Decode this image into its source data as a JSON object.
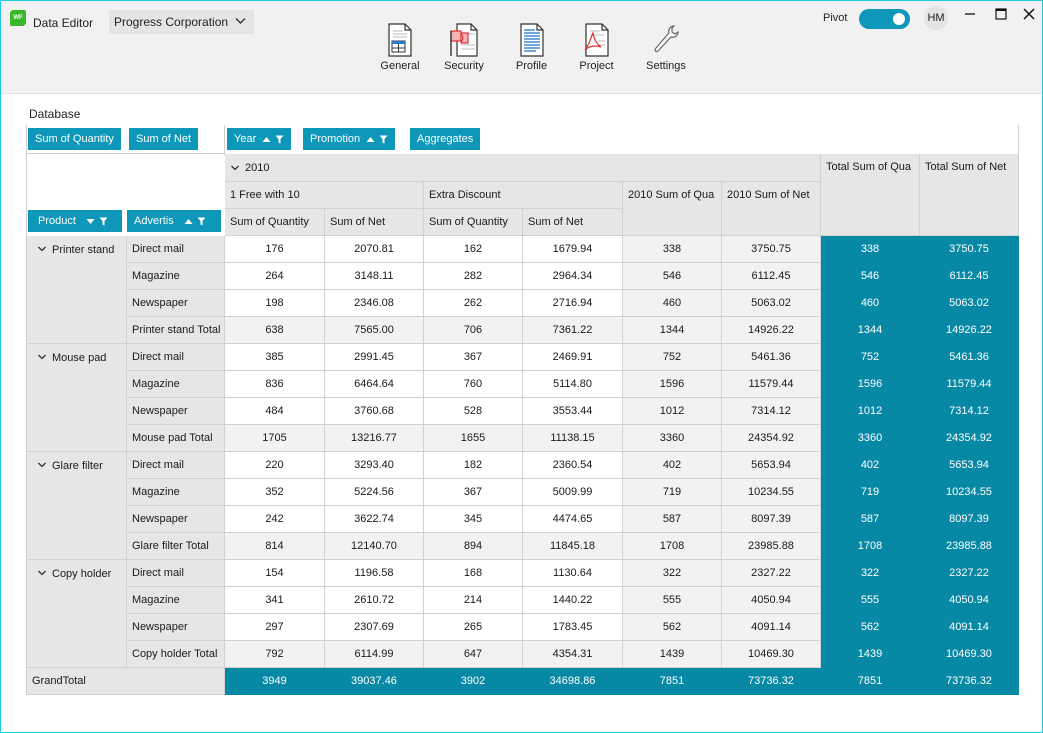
{
  "app": {
    "title": "Data Editor",
    "logo_text": "WF",
    "company": "Progress Corporation"
  },
  "ribbon": [
    {
      "label": "General",
      "icon": "general-doc-icon"
    },
    {
      "label": "Security",
      "icon": "security-flag-icon"
    },
    {
      "label": "Profile",
      "icon": "profile-doc-icon"
    },
    {
      "label": "Project",
      "icon": "project-pdf-icon"
    },
    {
      "label": "Settings",
      "icon": "settings-wrench-icon"
    }
  ],
  "header_right": {
    "pivot_label": "Pivot",
    "pivot_on": true,
    "avatar_initials": "HM"
  },
  "section_title": "Database",
  "fields": {
    "data_fields": [
      "Sum of Quantity",
      "Sum of Net"
    ],
    "column_fields": [
      "Year",
      "Promotion",
      "Aggregates"
    ],
    "row_fields": [
      "Product",
      "Advertis"
    ]
  },
  "pivot": {
    "year": "2010",
    "promotions": [
      "1 Free with 10",
      "Extra Discount"
    ],
    "measure_headers": [
      "Sum of Quantity",
      "Sum of Net",
      "Sum of Quantity",
      "Sum of Net"
    ],
    "year_total_headers": [
      "2010 Sum of Qua",
      "2010 Sum of Net"
    ],
    "grand_total_headers": [
      "Total Sum of Qua",
      "Total Sum of Net"
    ],
    "groups": [
      {
        "product": "Printer stand",
        "rows": [
          {
            "label": "Direct mail",
            "values": [
              "176",
              "2070.81",
              "162",
              "1679.94",
              "338",
              "3750.75",
              "338",
              "3750.75"
            ]
          },
          {
            "label": "Magazine",
            "values": [
              "264",
              "3148.11",
              "282",
              "2964.34",
              "546",
              "6112.45",
              "546",
              "6112.45"
            ]
          },
          {
            "label": "Newspaper",
            "values": [
              "198",
              "2346.08",
              "262",
              "2716.94",
              "460",
              "5063.02",
              "460",
              "5063.02"
            ]
          },
          {
            "label": "Printer stand Total",
            "values": [
              "638",
              "7565.00",
              "706",
              "7361.22",
              "1344",
              "14926.22",
              "1344",
              "14926.22"
            ]
          }
        ]
      },
      {
        "product": "Mouse pad",
        "rows": [
          {
            "label": "Direct mail",
            "values": [
              "385",
              "2991.45",
              "367",
              "2469.91",
              "752",
              "5461.36",
              "752",
              "5461.36"
            ]
          },
          {
            "label": "Magazine",
            "values": [
              "836",
              "6464.64",
              "760",
              "5114.80",
              "1596",
              "11579.44",
              "1596",
              "11579.44"
            ]
          },
          {
            "label": "Newspaper",
            "values": [
              "484",
              "3760.68",
              "528",
              "3553.44",
              "1012",
              "7314.12",
              "1012",
              "7314.12"
            ]
          },
          {
            "label": "Mouse pad Total",
            "values": [
              "1705",
              "13216.77",
              "1655",
              "11138.15",
              "3360",
              "24354.92",
              "3360",
              "24354.92"
            ]
          }
        ]
      },
      {
        "product": "Glare filter",
        "rows": [
          {
            "label": "Direct mail",
            "values": [
              "220",
              "3293.40",
              "182",
              "2360.54",
              "402",
              "5653.94",
              "402",
              "5653.94"
            ]
          },
          {
            "label": "Magazine",
            "values": [
              "352",
              "5224.56",
              "367",
              "5009.99",
              "719",
              "10234.55",
              "719",
              "10234.55"
            ]
          },
          {
            "label": "Newspaper",
            "values": [
              "242",
              "3622.74",
              "345",
              "4474.65",
              "587",
              "8097.39",
              "587",
              "8097.39"
            ]
          },
          {
            "label": "Glare filter Total",
            "values": [
              "814",
              "12140.70",
              "894",
              "11845.18",
              "1708",
              "23985.88",
              "1708",
              "23985.88"
            ]
          }
        ]
      },
      {
        "product": "Copy holder",
        "rows": [
          {
            "label": "Direct mail",
            "values": [
              "154",
              "1196.58",
              "168",
              "1130.64",
              "322",
              "2327.22",
              "322",
              "2327.22"
            ]
          },
          {
            "label": "Magazine",
            "values": [
              "341",
              "2610.72",
              "214",
              "1440.22",
              "555",
              "4050.94",
              "555",
              "4050.94"
            ]
          },
          {
            "label": "Newspaper",
            "values": [
              "297",
              "2307.69",
              "265",
              "1783.45",
              "562",
              "4091.14",
              "562",
              "4091.14"
            ]
          },
          {
            "label": "Copy holder Total",
            "values": [
              "792",
              "6114.99",
              "647",
              "4354.31",
              "1439",
              "10469.30",
              "1439",
              "10469.30"
            ]
          }
        ]
      }
    ],
    "grand_total": {
      "label": "GrandTotal",
      "values": [
        "3949",
        "39037.46",
        "3902",
        "34698.86",
        "7851",
        "73736.32",
        "7851",
        "73736.32"
      ]
    }
  },
  "colors": {
    "accent": "#0d97b9",
    "total_fill": "#0788a5",
    "header_fill": "#e6e6e6",
    "subtotal_fill": "#f2f2f2"
  }
}
